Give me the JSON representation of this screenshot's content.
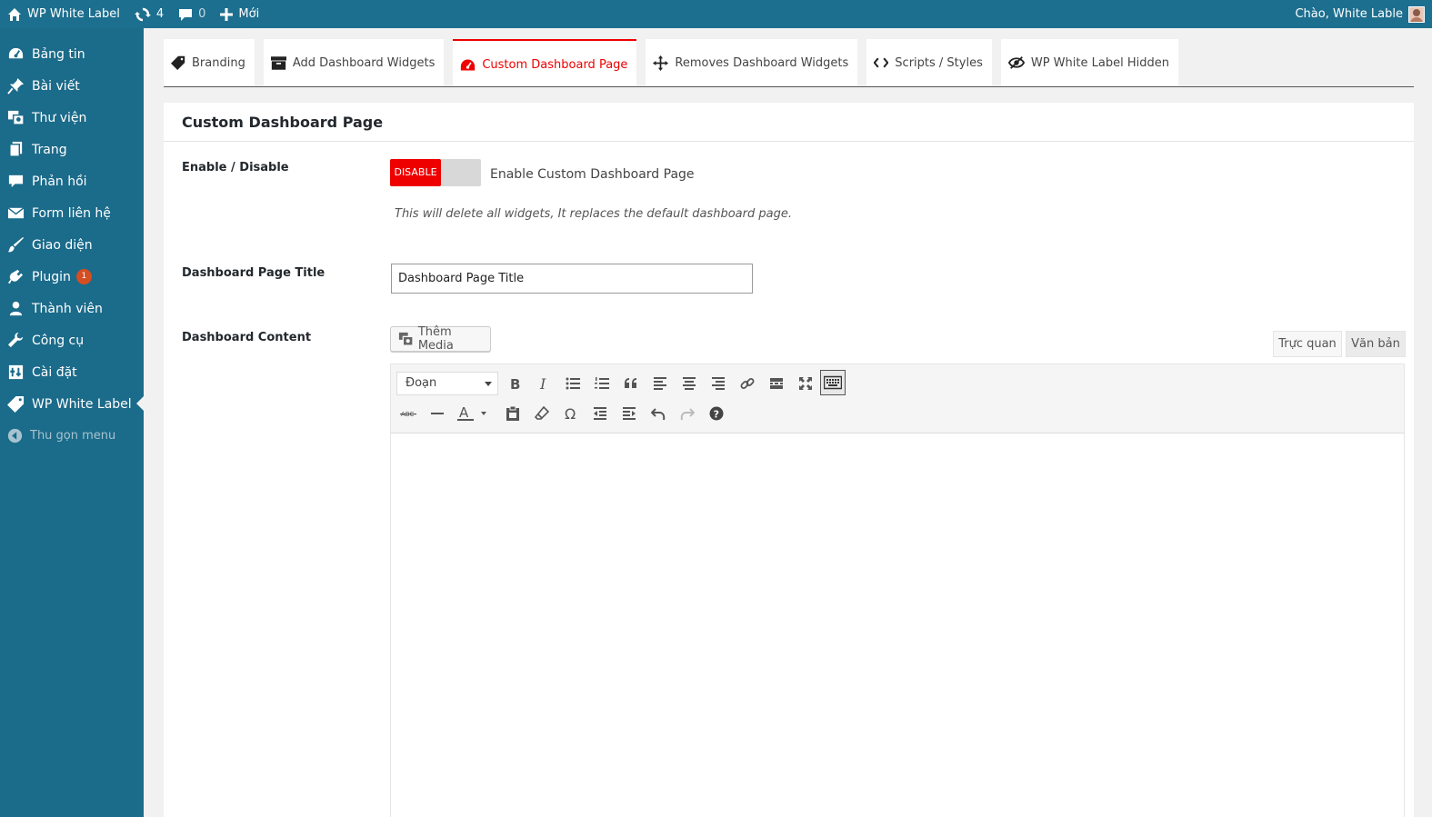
{
  "admin_bar": {
    "site_name": "WP White Label",
    "updates_count": "4",
    "comments_count": "0",
    "new_label": "Mới",
    "greeting": "Chào, White Lable"
  },
  "sidebar": {
    "items": [
      {
        "label": "Bảng tin",
        "icon": "dashboard-icon"
      },
      {
        "label": "Bài viết",
        "icon": "pin-icon"
      },
      {
        "label": "Thư viện",
        "icon": "media-icon"
      },
      {
        "label": "Trang",
        "icon": "pages-icon"
      },
      {
        "label": "Phản hồi",
        "icon": "comments-icon"
      },
      {
        "label": "Form liên hệ",
        "icon": "mail-icon"
      },
      {
        "label": "Giao diện",
        "icon": "appearance-icon"
      },
      {
        "label": "Plugin",
        "icon": "plugin-icon",
        "badge": "1"
      },
      {
        "label": "Thành viên",
        "icon": "users-icon"
      },
      {
        "label": "Công cụ",
        "icon": "tools-icon"
      },
      {
        "label": "Cài đặt",
        "icon": "settings-icon"
      },
      {
        "label": "WP White Label",
        "icon": "tag-icon",
        "current": true
      }
    ],
    "collapse_label": "Thu gọn menu"
  },
  "tabs": [
    {
      "label": "Branding",
      "icon": "tag-icon"
    },
    {
      "label": "Add Dashboard Widgets",
      "icon": "archive-icon"
    },
    {
      "label": "Custom Dashboard Page",
      "icon": "dashboard-gauge-icon",
      "active": true
    },
    {
      "label": "Removes Dashboard Widgets",
      "icon": "move-icon"
    },
    {
      "label": "Scripts / Styles",
      "icon": "code-icon"
    },
    {
      "label": "WP White Label Hidden",
      "icon": "eye-slash-icon"
    }
  ],
  "panel": {
    "title": "Custom Dashboard Page",
    "enable_label": "Enable / Disable",
    "toggle_state": "DISABLE",
    "toggle_text": "Enable Custom Dashboard Page",
    "toggle_hint": "This will delete all widgets, It replaces the default dashboard page.",
    "title_label": "Dashboard Page Title",
    "title_value": "Dashboard Page Title",
    "content_label": "Dashboard Content",
    "add_media": "Thêm Media",
    "visual_tab": "Trực quan",
    "text_tab": "Văn bản",
    "format_select": "Đoạn"
  },
  "colors": {
    "admin_bar": "#1d6f8f",
    "sidebar": "#1b6b8a",
    "accent_red": "#ee0000"
  }
}
